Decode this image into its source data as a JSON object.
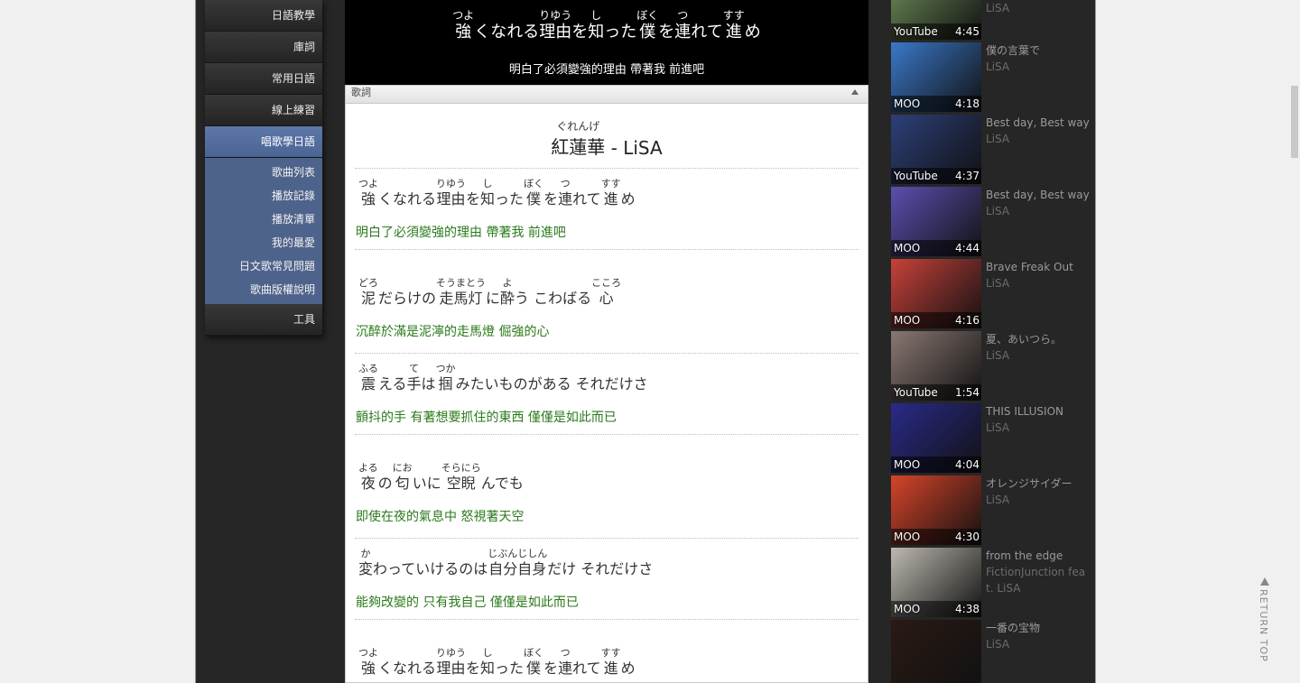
{
  "nav": {
    "items": [
      "日語教學",
      "庫詞",
      "常用日語",
      "線上練習"
    ],
    "active": "唱歌學日語",
    "sub_items": [
      "歌曲列表",
      "播放記錄",
      "播放清單",
      "我的最愛",
      "日文歌常見問題",
      "歌曲版權說明"
    ],
    "tools": "工具"
  },
  "player": {
    "jp_segments": [
      {
        "rt": "つよ",
        "base": "強"
      },
      {
        "rt": "",
        "base": "くなれる"
      },
      {
        "rt": "りゆう",
        "base": "理由"
      },
      {
        "rt": "",
        "base": "を"
      },
      {
        "rt": "し",
        "base": "知"
      },
      {
        "rt": "",
        "base": "った "
      },
      {
        "rt": "ぼく",
        "base": "僕"
      },
      {
        "rt": "",
        "base": "を"
      },
      {
        "rt": "つ",
        "base": "連"
      },
      {
        "rt": "",
        "base": "れて"
      },
      {
        "rt": "すす",
        "base": "進"
      },
      {
        "rt": "",
        "base": "め"
      }
    ],
    "zh": "明白了必須變強的理由 帶著我 前進吧"
  },
  "lyrics": {
    "header": "歌詞",
    "title_rt": "ぐれんげ",
    "title_base": "紅蓮華",
    "title_rest": " - LiSA",
    "lines": [
      {
        "segments": [
          {
            "rt": "つよ",
            "base": "強"
          },
          {
            "rt": "",
            "base": "くなれる"
          },
          {
            "rt": "りゆう",
            "base": "理由"
          },
          {
            "rt": "",
            "base": "を"
          },
          {
            "rt": "し",
            "base": "知"
          },
          {
            "rt": "",
            "base": "った "
          },
          {
            "rt": "ぼく",
            "base": "僕"
          },
          {
            "rt": "",
            "base": "を"
          },
          {
            "rt": "つ",
            "base": "連"
          },
          {
            "rt": "",
            "base": "れて"
          },
          {
            "rt": "すす",
            "base": "進"
          },
          {
            "rt": "",
            "base": "め"
          }
        ],
        "zh": "明白了必須變強的理由 帶著我 前進吧"
      },
      {
        "segments": [
          {
            "rt": "どろ",
            "base": "泥"
          },
          {
            "rt": "",
            "base": "だらけの "
          },
          {
            "rt": "そうまとう",
            "base": "走馬灯"
          },
          {
            "rt": "",
            "base": "に"
          },
          {
            "rt": "よ",
            "base": "酔"
          },
          {
            "rt": "",
            "base": "う こわばる "
          },
          {
            "rt": "こころ",
            "base": "心"
          }
        ],
        "zh": "沉醉於滿是泥濘的走馬燈 倔強的心"
      },
      {
        "segments": [
          {
            "rt": "ふる",
            "base": "震"
          },
          {
            "rt": "",
            "base": "える"
          },
          {
            "rt": "て",
            "base": "手"
          },
          {
            "rt": "",
            "base": "は"
          },
          {
            "rt": "つか",
            "base": "掴"
          },
          {
            "rt": "",
            "base": "みたいものがある それだけさ"
          }
        ],
        "zh": "顫抖的手 有著想要抓住的東西 僅僅是如此而已"
      },
      {
        "segments": [
          {
            "rt": "よる",
            "base": "夜"
          },
          {
            "rt": "",
            "base": "の"
          },
          {
            "rt": "にお",
            "base": "匂"
          },
          {
            "rt": "",
            "base": "いに"
          },
          {
            "rt": "そらにら",
            "base": "空睨"
          },
          {
            "rt": "",
            "base": "んでも"
          }
        ],
        "zh": "即使在夜的氣息中 怒視著天空"
      },
      {
        "segments": [
          {
            "rt": "か",
            "base": "変"
          },
          {
            "rt": "",
            "base": "わっていけるのは"
          },
          {
            "rt": "じぶんじしん",
            "base": "自分自身"
          },
          {
            "rt": "",
            "base": "だけ それだけさ"
          }
        ],
        "zh": "能夠改變的 只有我自己 僅僅是如此而已"
      },
      {
        "segments": [
          {
            "rt": "つよ",
            "base": "強"
          },
          {
            "rt": "",
            "base": "くなれる"
          },
          {
            "rt": "りゆう",
            "base": "理由"
          },
          {
            "rt": "",
            "base": "を"
          },
          {
            "rt": "し",
            "base": "知"
          },
          {
            "rt": "",
            "base": "った "
          },
          {
            "rt": "ぼく",
            "base": "僕"
          },
          {
            "rt": "",
            "base": "を"
          },
          {
            "rt": "つ",
            "base": "連"
          },
          {
            "rt": "",
            "base": "れて"
          },
          {
            "rt": "すす",
            "base": "進"
          },
          {
            "rt": "",
            "base": "め"
          }
        ],
        "zh": ""
      }
    ]
  },
  "videos": [
    {
      "source": "YouTube",
      "duration": "4:45",
      "title": "",
      "artist": "LiSA",
      "color": "#6f8f5a"
    },
    {
      "source": "MOO",
      "duration": "4:18",
      "title": "僕の言葉で",
      "artist": "LiSA",
      "color": "#3a78c9"
    },
    {
      "source": "YouTube",
      "duration": "4:37",
      "title": "Best day, Best way",
      "artist": "LiSA",
      "color": "#2c3f78"
    },
    {
      "source": "MOO",
      "duration": "4:44",
      "title": "Best day, Best way",
      "artist": "LiSA",
      "color": "#5a4fb0"
    },
    {
      "source": "MOO",
      "duration": "4:16",
      "title": "Brave Freak Out",
      "artist": "LiSA",
      "color": "#c8413a"
    },
    {
      "source": "YouTube",
      "duration": "1:54",
      "title": "夏、あいつら。",
      "artist": "LiSA",
      "color": "#8a7872"
    },
    {
      "source": "MOO",
      "duration": "4:04",
      "title": "THIS ILLUSION",
      "artist": "LiSA",
      "color": "#2a2a8a"
    },
    {
      "source": "MOO",
      "duration": "4:30",
      "title": "オレンジサイダー",
      "artist": "LiSA",
      "color": "#d6442a"
    },
    {
      "source": "MOO",
      "duration": "4:38",
      "title": "from the edge",
      "artist": "FictionJunction feat. LiSA",
      "color": "#bdbab0"
    },
    {
      "source": "",
      "duration": "",
      "title": "一番の宝物",
      "artist": "LiSA",
      "color": "#2a1a14"
    }
  ],
  "return_top": "RETURN TOP"
}
